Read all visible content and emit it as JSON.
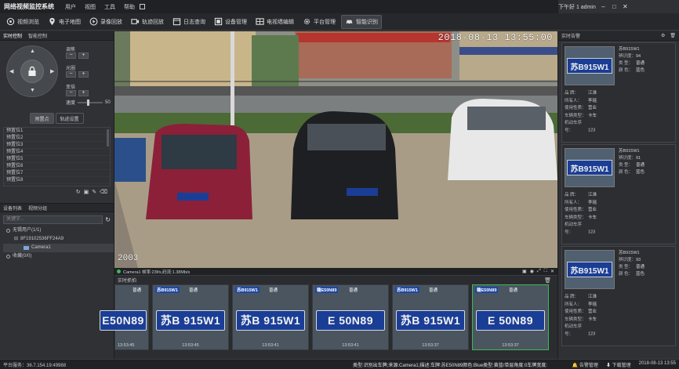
{
  "titlebar": {
    "title": "网络视频监控系统",
    "menu": [
      "用户",
      "视图",
      "工具",
      "帮助"
    ],
    "welcome": "下午好 1 admin"
  },
  "toolbar": [
    {
      "icon": "camera-icon",
      "label": "视频浏览"
    },
    {
      "icon": "map-pin-icon",
      "label": "电子地图"
    },
    {
      "icon": "play-circle-icon",
      "label": "录像回放"
    },
    {
      "icon": "video-playback-icon",
      "label": "轨迹回放"
    },
    {
      "icon": "calendar-icon",
      "label": "日志查询"
    },
    {
      "icon": "device-icon",
      "label": "设备管理"
    },
    {
      "icon": "grid-icon",
      "label": "电视墙编辑"
    },
    {
      "icon": "gear-icon",
      "label": "平台管理"
    },
    {
      "icon": "car-icon",
      "label": "智能识别",
      "active": true
    }
  ],
  "left": {
    "tabs": [
      "实时控制",
      "智能控制"
    ],
    "ptz_controls": [
      "调焦",
      "光圈",
      "变倍"
    ],
    "speed_label": "速度",
    "speed_value": "50",
    "subtabs": [
      "预置点",
      "轨迹设置"
    ],
    "presets": [
      "预置位1",
      "预置位2",
      "预置位3",
      "预置位4",
      "预置位5",
      "预置位6",
      "预置位7",
      "预置位8"
    ],
    "device_tabs": [
      "设备列表",
      "视频分组"
    ],
    "search_placeholder": "关键字...",
    "tree": [
      {
        "label": "无锡用户(1/1)",
        "level": 0
      },
      {
        "label": "8F19102536FF24A9",
        "level": 1
      },
      {
        "label": "Camera1",
        "level": 2,
        "selected": true
      },
      {
        "label": "收藏(0/0)",
        "level": 0
      }
    ]
  },
  "video": {
    "osd_time": "2018-08-13 13:55:00",
    "osd_id": "2003",
    "status_text": "Camera1  帧率:23f/s,码流:1.38Mb/s"
  },
  "captures": {
    "title": "实时抓拍",
    "items": [
      {
        "plate": "E50N89",
        "time": "13:53:45",
        "type": "普通",
        "prov": ""
      },
      {
        "plate": "苏B 915W1",
        "time": "13:53:45",
        "type": "普通",
        "prov": "苏B915W1"
      },
      {
        "plate": "苏B 915W1",
        "time": "13:53:41",
        "type": "普通",
        "prov": "苏B915W1"
      },
      {
        "plate": "E 50N89",
        "time": "13:53:41",
        "type": "普通",
        "prov": "赣E50N89"
      },
      {
        "plate": "苏B 915W1",
        "time": "13:53:37",
        "type": "普通",
        "prov": "苏B915W1"
      },
      {
        "plate": "E 50N89",
        "time": "13:53:37",
        "type": "普通",
        "prov": "赣E50N89"
      }
    ]
  },
  "right": {
    "title": "实时告警",
    "cards": [
      {
        "thumb_plate": "苏B915W1",
        "plate": "苏B915W1",
        "confidence": "94",
        "type": "普通",
        "color": "蓝色",
        "owner": "李瑶",
        "province": "江淮",
        "nature": "营业",
        "vtype": "卡车",
        "seq": "123"
      },
      {
        "thumb_plate": "苏B915W1",
        "plate": "苏B915W1",
        "confidence": "91",
        "type": "普通",
        "color": "蓝色",
        "owner": "李瑶",
        "province": "江淮",
        "nature": "营业",
        "vtype": "卡车",
        "seq": "123"
      },
      {
        "thumb_plate": "苏B915W1",
        "plate": "苏B915W1",
        "confidence": "93",
        "type": "普通",
        "color": "蓝色",
        "owner": "李瑶",
        "province": "江淮",
        "nature": "营业",
        "vtype": "卡车",
        "seq": "123"
      }
    ],
    "labels": {
      "confidence": "辨识度：",
      "type": "类 型：",
      "color": "颜 色：",
      "province": "品 牌：",
      "owner": "所有人：",
      "nature": "使用性质：",
      "vtype": "车辆类型：",
      "seq": "机动车序号："
    }
  },
  "status": {
    "server": "平台服务：36.7.154.19:49988",
    "alarm": "类型:识别出车牌;来源:Camera1;描述:车牌:苏E50N89颜色:Blue类型:黄蓝/单层角度:0车牌宽度:144;",
    "alarm_label": "告警管理",
    "download_label": "下载管理",
    "clock": "2018-08-13 13:55"
  },
  "colors": {
    "accent_green": "#3cba54",
    "plate_blue": "#1a3e96",
    "alarm_red": "#d33"
  }
}
